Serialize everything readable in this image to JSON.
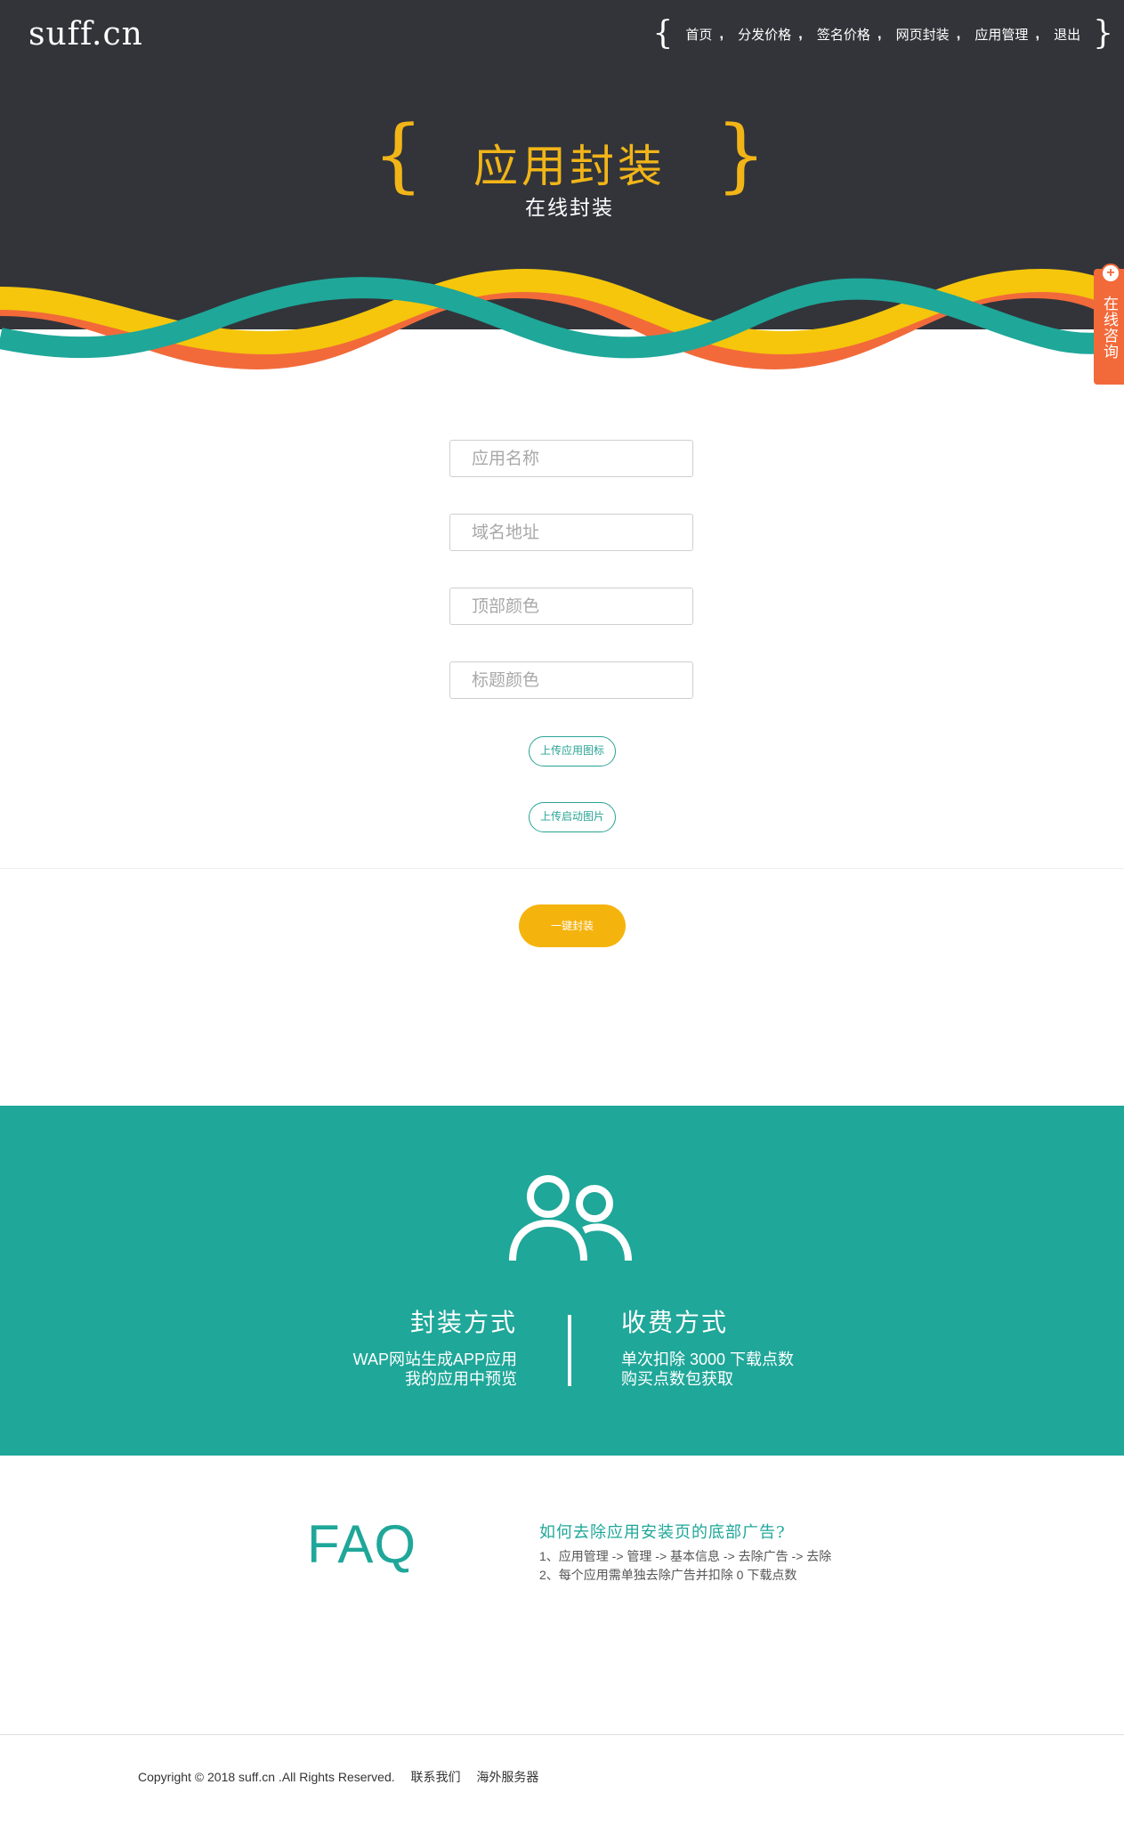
{
  "header": {
    "logo": "suff.cn",
    "nav": [
      {
        "label": "首页"
      },
      {
        "label": "分发价格"
      },
      {
        "label": "签名价格"
      },
      {
        "label": "网页封装"
      },
      {
        "label": "应用管理"
      },
      {
        "label": "退出"
      }
    ],
    "nav_separator": ",",
    "brace_open": "{",
    "brace_close": "}"
  },
  "hero": {
    "title": "应用封装",
    "subtitle": "在线封装",
    "wave_colors": [
      "#f26a3a",
      "#f5c60c",
      "#1fa799"
    ]
  },
  "consult": {
    "plus": "+",
    "label": "在线咨询"
  },
  "form": {
    "fields": [
      {
        "placeholder": "应用名称",
        "value": ""
      },
      {
        "placeholder": "域名地址",
        "value": ""
      },
      {
        "placeholder": "顶部颜色",
        "value": ""
      },
      {
        "placeholder": "标题颜色",
        "value": ""
      }
    ],
    "upload_icon_label": "上传应用图标",
    "upload_splash_label": "上传启动图片",
    "submit_label": "一键封装"
  },
  "info": {
    "icon": "users-icon",
    "left": {
      "title": "封装方式",
      "lines": [
        "WAP网站生成APP应用",
        "我的应用中预览"
      ]
    },
    "right": {
      "title": "收费方式",
      "lines": [
        "单次扣除 3000 下载点数",
        "购买点数包获取"
      ]
    }
  },
  "faq": {
    "heading": "FAQ",
    "question": "如何去除应用安装页的底部广告?",
    "answers": [
      "1、应用管理 -> 管理 -> 基本信息 -> 去除广告 -> 去除",
      "2、每个应用需单独去除广告并扣除 0 下载点数"
    ]
  },
  "footer": {
    "copyright": "Copyright © 2018 suff.cn .All Rights Reserved.",
    "links": [
      "联系我们",
      "海外服务器"
    ]
  },
  "colors": {
    "header_bg": "#32343a",
    "accent_yellow": "#f2b518",
    "teal": "#1fa799",
    "orange": "#f26a3a",
    "button_yellow": "#f5b30d"
  }
}
